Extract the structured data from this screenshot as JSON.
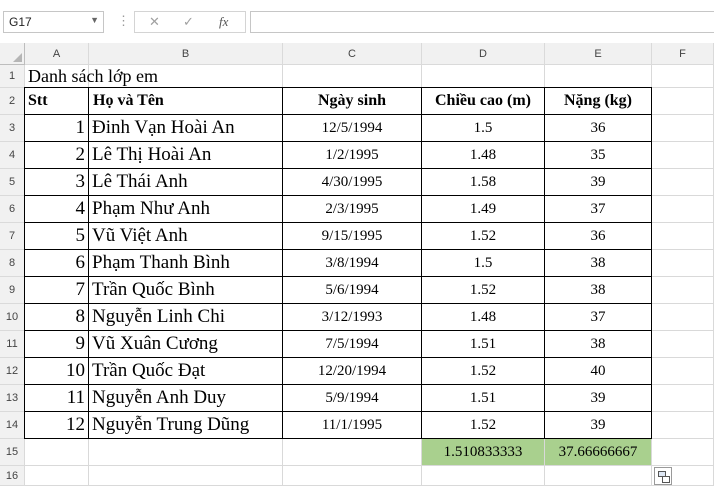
{
  "name_box": {
    "value": "G17",
    "arrow": "▼"
  },
  "formula_bar": {
    "separator": "⋮",
    "cancel": "✕",
    "enter": "✓",
    "function": "fx",
    "value": ""
  },
  "column_headers": [
    "A",
    "B",
    "C",
    "D",
    "E",
    "F"
  ],
  "row_headers": [
    "1",
    "2",
    "3",
    "4",
    "5",
    "6",
    "7",
    "8",
    "9",
    "10",
    "11",
    "12",
    "13",
    "14",
    "15",
    "16"
  ],
  "sheet": {
    "title": "Danh sách lớp em",
    "headers": [
      "Stt",
      "Họ và Tên",
      "Ngày sinh",
      "Chiều cao (m)",
      "Nặng (kg)"
    ],
    "rows": [
      [
        "1",
        "Đinh Vạn Hoài An",
        "12/5/1994",
        "1.5",
        "36"
      ],
      [
        "2",
        "Lê Thị Hoài An",
        "1/2/1995",
        "1.48",
        "35"
      ],
      [
        "3",
        "Lê Thái Anh",
        "4/30/1995",
        "1.58",
        "39"
      ],
      [
        "4",
        "Phạm Như Anh",
        "2/3/1995",
        "1.49",
        "37"
      ],
      [
        "5",
        "Vũ Việt Anh",
        "9/15/1995",
        "1.52",
        "36"
      ],
      [
        "6",
        "Phạm Thanh Bình",
        "3/8/1994",
        "1.5",
        "38"
      ],
      [
        "7",
        "Trần Quốc Bình",
        "5/6/1994",
        "1.52",
        "38"
      ],
      [
        "8",
        "Nguyễn Linh Chi",
        "3/12/1993",
        "1.48",
        "37"
      ],
      [
        "9",
        "Vũ Xuân Cương",
        "7/5/1994",
        "1.51",
        "38"
      ],
      [
        "10",
        "Trần Quốc Đạt",
        "12/20/1994",
        "1.52",
        "40"
      ],
      [
        "11",
        "Nguyễn Anh Duy",
        "5/9/1994",
        "1.51",
        "39"
      ],
      [
        "12",
        "Nguyễn Trung Dũng",
        "11/1/1995",
        "1.52",
        "39"
      ]
    ],
    "averages": [
      "1.510833333",
      "37.66666667"
    ]
  },
  "colors": {
    "average_fill": "#a9d08e",
    "header_bg": "#f1f1f1"
  },
  "icons": {
    "paste_options": "paste-options-icon",
    "select_all": "select-all-triangle"
  }
}
